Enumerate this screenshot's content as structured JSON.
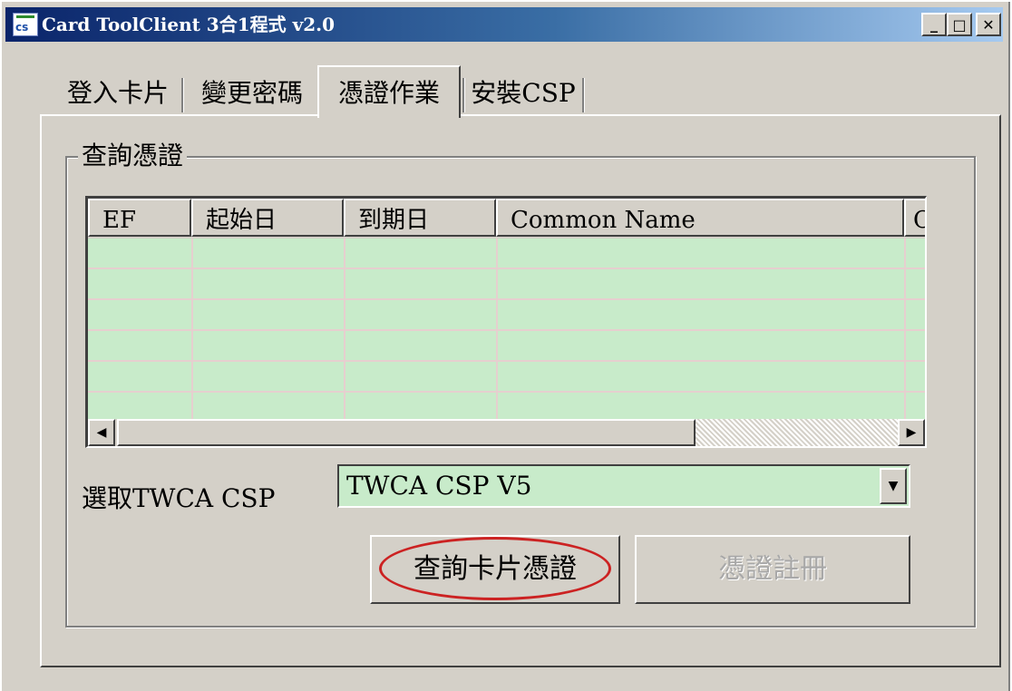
{
  "window": {
    "title": "Card ToolClient 3合1程式 v2.0",
    "icon_text": "cs",
    "controls": {
      "minimize": "_",
      "maximize": "□",
      "close": "✕"
    }
  },
  "tabs": [
    {
      "label": "登入卡片",
      "active": false
    },
    {
      "label": "變更密碼",
      "active": false
    },
    {
      "label": "憑證作業",
      "active": true
    },
    {
      "label": "安裝CSP",
      "active": false
    }
  ],
  "group": {
    "label": "查詢憑證",
    "list": {
      "columns": [
        "EF",
        "起始日",
        "到期日",
        "Common Name",
        "C"
      ],
      "row_count": 6
    },
    "csp_label": "選取TWCA CSP",
    "csp_select": {
      "value": "TWCA CSP V5"
    },
    "buttons": {
      "query": "查詢卡片憑證",
      "register": "憑證註冊"
    }
  },
  "colors": {
    "title_start": "#0a246a",
    "title_end": "#a6caf0",
    "list_bg": "#c8ebca",
    "highlight": "#cc2222"
  }
}
